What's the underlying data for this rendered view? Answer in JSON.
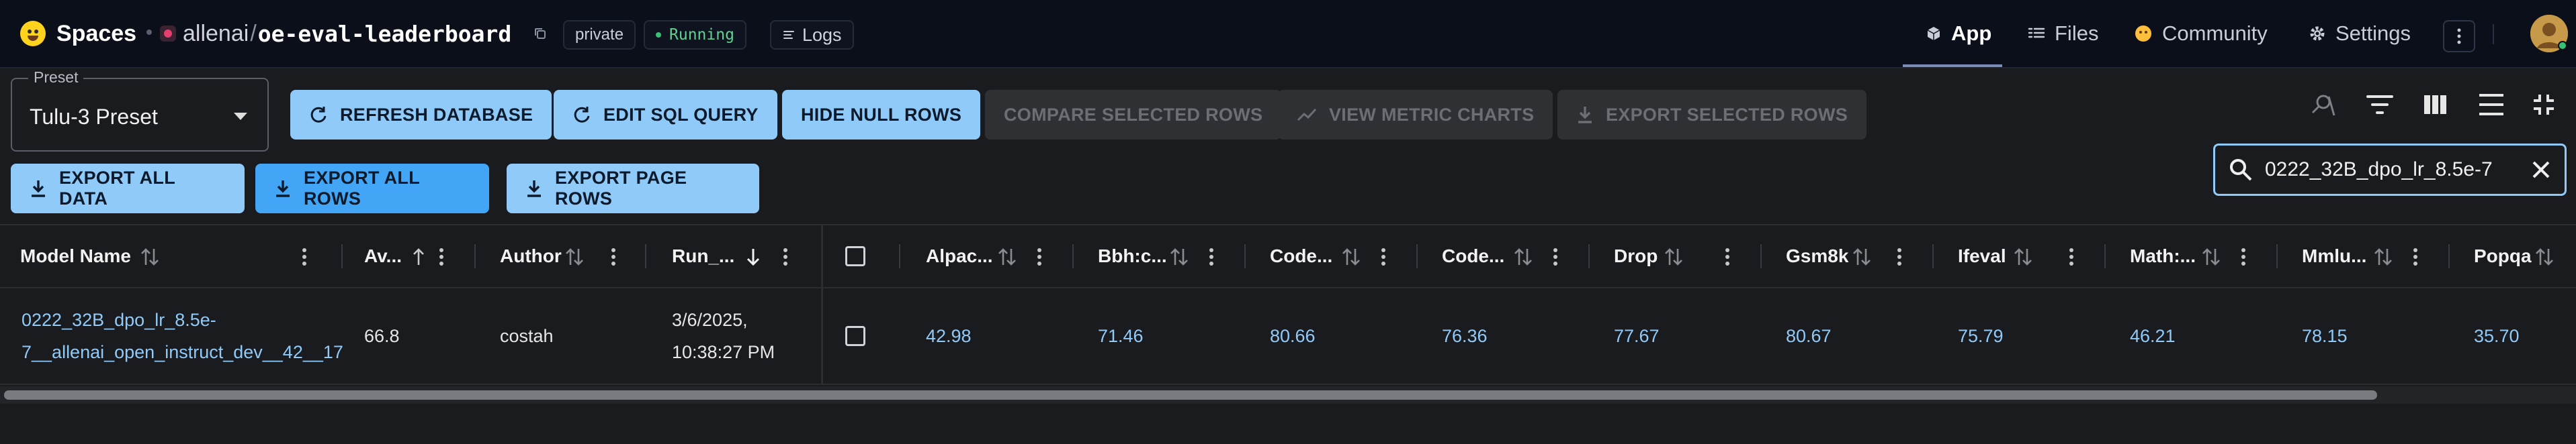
{
  "header": {
    "brand": "Spaces",
    "org": "allenai",
    "slash": "/",
    "repo": "oe-eval-leaderboard",
    "private_badge": "private",
    "status_badge": "Running",
    "logs_label": "Logs",
    "nav": {
      "app": "App",
      "files": "Files",
      "community": "Community",
      "settings": "Settings"
    }
  },
  "preset": {
    "label": "Preset",
    "value": "Tulu-3 Preset"
  },
  "toolbar": {
    "refresh": "REFRESH DATABASE",
    "edit_sql": "EDIT SQL QUERY",
    "hide_null": "HIDE NULL ROWS",
    "compare": "COMPARE SELECTED ROWS",
    "view_charts": "VIEW METRIC CHARTS",
    "export_selected": "EXPORT SELECTED ROWS",
    "export_all_data": "EXPORT ALL DATA",
    "export_all_rows": "EXPORT ALL ROWS",
    "export_page_rows": "EXPORT PAGE ROWS"
  },
  "search": {
    "value": "0222_32B_dpo_lr_8.5e-7"
  },
  "table": {
    "headers": {
      "model": "Model Name",
      "avg": "Av...",
      "author": "Author",
      "run": "Run_...",
      "alpaca": "Alpac...",
      "bbh": "Bbh:c...",
      "code1": "Code...",
      "code2": "Code...",
      "drop": "Drop",
      "gsm8k": "Gsm8k",
      "ifeval": "Ifeval",
      "math": "Math:...",
      "mmlu": "Mmlu...",
      "popqa": "Popqa"
    },
    "row": {
      "model_line1": "0222_32B_dpo_lr_8.5e-",
      "model_line2": "7__allenai_open_instruct_dev__42__17",
      "avg": "66.8",
      "author": "costah",
      "run_line1": "3/6/2025,",
      "run_line2": "10:38:27 PM",
      "alpaca": "42.98",
      "bbh": "71.46",
      "code1": "80.66",
      "code2": "76.36",
      "drop": "77.67",
      "gsm8k": "80.67",
      "ifeval": "75.79",
      "math": "46.21",
      "mmlu": "78.15",
      "popqa": "35.70"
    }
  },
  "colors": {
    "accent": "#90caf9",
    "primary": "#42a5f5",
    "running": "#5fd38f"
  }
}
